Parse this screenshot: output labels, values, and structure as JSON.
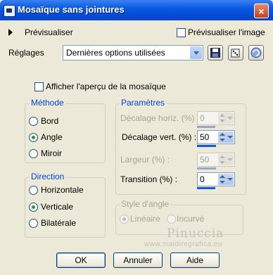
{
  "window": {
    "title": "Mosaïque sans jointures",
    "close_label": "×"
  },
  "preview": {
    "label": "Prévisualiser",
    "image_checkbox_label": "Prévisualiser l'image",
    "image_checked": false
  },
  "settings": {
    "label": "Réglages",
    "value": "Dernières options utilisées"
  },
  "show_preview": {
    "label": "Afficher l'aperçu de la mosaïque",
    "checked": false
  },
  "method": {
    "title": "Méthode",
    "options": [
      {
        "label": "Bord",
        "selected": false
      },
      {
        "label": "Angle",
        "selected": true
      },
      {
        "label": "Miroir",
        "selected": false
      }
    ]
  },
  "direction": {
    "title": "Direction",
    "options": [
      {
        "label": "Horizontale",
        "selected": false
      },
      {
        "label": "Verticale",
        "selected": true
      },
      {
        "label": "Bilatérale",
        "selected": false
      }
    ]
  },
  "params": {
    "title": "Paramètres",
    "fields": [
      {
        "label": "Décalage horiz. (%) :",
        "value": "0",
        "enabled": false,
        "level_percent": 0
      },
      {
        "label": "Décalage vert. (%) :",
        "value": "50",
        "enabled": true,
        "level_percent": 50
      },
      {
        "label": "Largeur (%) :",
        "value": "50",
        "enabled": false,
        "level_percent": 50
      },
      {
        "label": "Transition (%) :",
        "value": "0",
        "enabled": true,
        "level_percent": 0
      }
    ]
  },
  "corner_style": {
    "title": "Style d'angle",
    "options": [
      {
        "label": "Linéaire",
        "selected": true
      },
      {
        "label": "Incurvé",
        "selected": false
      }
    ]
  },
  "buttons": {
    "ok": "OK",
    "cancel": "Annuler",
    "help": "Aide"
  },
  "watermark": {
    "line1": "Pinuccia",
    "line2": "www.maidiregrafica.eu"
  },
  "colors": {
    "title_bar": "#0a5be0",
    "group_title": "#0046d5",
    "dialog_bg": "#ECE9D8"
  },
  "icons": {
    "save": "save-icon",
    "random": "dice-icon",
    "reset": "reset-icon"
  }
}
